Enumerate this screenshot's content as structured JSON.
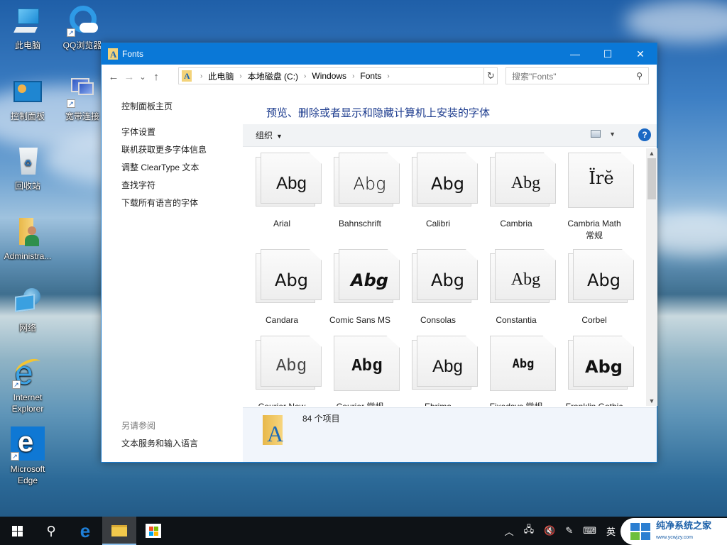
{
  "desktop": {
    "icons": [
      {
        "label": "此电脑",
        "icon": "this-pc-icon"
      },
      {
        "label": "QQ浏览器",
        "icon": "qq-browser-icon"
      },
      {
        "label": "控制面板",
        "icon": "control-panel-icon"
      },
      {
        "label": "宽带连接",
        "icon": "broadband-icon"
      },
      {
        "label": "回收站",
        "icon": "recycle-bin-icon"
      },
      {
        "label": "Administra...",
        "icon": "user-folder-icon"
      },
      {
        "label": "网络",
        "icon": "network-icon"
      },
      {
        "label": "Internet Explorer",
        "icon": "ie-icon"
      },
      {
        "label": "Microsoft Edge",
        "icon": "edge-icon"
      }
    ]
  },
  "window": {
    "title": "Fonts",
    "minimize": "—",
    "maximize": "☐",
    "close": "✕",
    "nav": {
      "back": "←",
      "forward": "→",
      "recent": "⌄",
      "up": "↑"
    },
    "breadcrumb": [
      "此电脑",
      "本地磁盘 (C:)",
      "Windows",
      "Fonts"
    ],
    "refresh": "↻",
    "search_placeholder": "搜索\"Fonts\"",
    "left_pane": {
      "home": "控制面板主页",
      "links": [
        "字体设置",
        "联机获取更多字体信息",
        "调整 ClearType 文本",
        "查找字符",
        "下载所有语言的字体"
      ],
      "see_also_title": "另请参阅",
      "see_also_links": [
        "文本服务和输入语言"
      ]
    },
    "heading": "预览、删除或者显示和隐藏计算机上安装的字体",
    "toolbar": {
      "organize": "组织",
      "caret": "▼",
      "help": "?"
    },
    "fonts": [
      {
        "name": "Arial",
        "sample": "Abg",
        "stacked": true
      },
      {
        "name": "Bahnschrift",
        "sample": "Abg",
        "stacked": true
      },
      {
        "name": "Calibri",
        "sample": "Abg",
        "stacked": true
      },
      {
        "name": "Cambria",
        "sample": "Abg",
        "stacked": true
      },
      {
        "name": "Cambria Math 常规",
        "sample": "Ïrĕ",
        "stacked": false
      },
      {
        "name": "Candara",
        "sample": "Abg",
        "stacked": true
      },
      {
        "name": "Comic Sans MS",
        "sample": "Abg",
        "stacked": true
      },
      {
        "name": "Consolas",
        "sample": "Abg",
        "stacked": true
      },
      {
        "name": "Constantia",
        "sample": "Abg",
        "stacked": true
      },
      {
        "name": "Corbel",
        "sample": "Abg",
        "stacked": true
      },
      {
        "name": "Courier New",
        "sample": "Abg",
        "stacked": true
      },
      {
        "name": "Courier 常规",
        "sample": "Abg",
        "stacked": false
      },
      {
        "name": "Ebrima",
        "sample": "Abg",
        "stacked": true
      },
      {
        "name": "Fixedsys 常规",
        "sample": "Abg",
        "stacked": false
      },
      {
        "name": "Franklin Gothic",
        "sample": "Abg",
        "stacked": true
      }
    ],
    "status": {
      "item_count": "84 个项目"
    }
  },
  "taskbar": {
    "items": [
      "start",
      "search",
      "edge",
      "file-explorer",
      "store"
    ],
    "tray": {
      "ime": "英"
    },
    "watermark": {
      "title": "纯净系统之家",
      "url": "www.ycwjzy.com"
    }
  },
  "colors": {
    "accent": "#0a78d7",
    "heading": "#1e3d8f"
  }
}
